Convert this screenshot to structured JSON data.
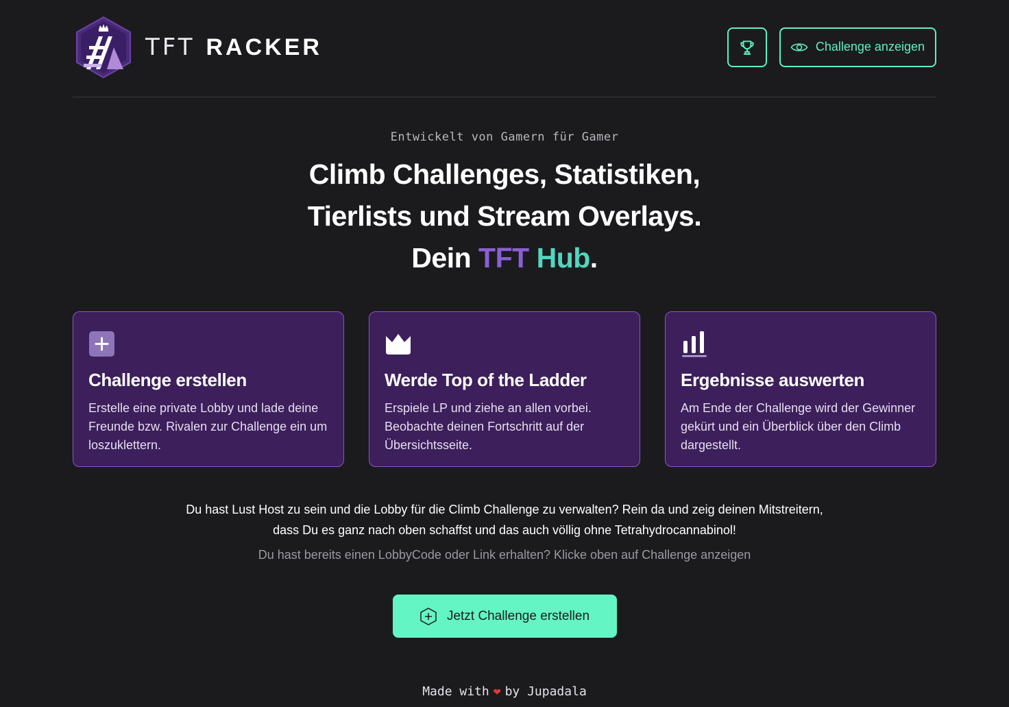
{
  "header": {
    "brand_light": "TFT",
    "brand_bold": "RACKER",
    "view_challenge_label": "Challenge anzeigen"
  },
  "hero": {
    "eyebrow": "Entwickelt von Gamern für Gamer",
    "line1": "Climb Challenges, Statistiken,",
    "line2": "Tierlists und Stream Overlays.",
    "line3_prefix": "Dein",
    "line3_tft": "TFT",
    "line3_hub": "Hub",
    "line3_dot": "."
  },
  "cards": [
    {
      "icon": "plus-square-icon",
      "title": "Challenge erstellen",
      "text": "Erstelle eine private Lobby und lade deine Freunde bzw. Rivalen zur Challenge ein um loszuklettern."
    },
    {
      "icon": "crown-icon",
      "title": "Werde Top of the Ladder",
      "text": "Erspiele LP und ziehe an allen vorbei. Beobachte deinen Fortschritt auf der Übersichtsseite."
    },
    {
      "icon": "bar-chart-icon",
      "title": "Ergebnisse auswerten",
      "text": "Am Ende der Challenge wird der Gewinner gekürt und ein Überblick über den Climb dargestellt."
    }
  ],
  "info": {
    "main_line1": "Du hast Lust Host zu sein und die Lobby für die Climb Challenge zu verwalten? Rein da und zeig deinen Mitstreitern,",
    "main_line2": "dass Du es ganz nach oben schaffst und das auch völlig ohne Tetrahydrocannabinol!",
    "sub": "Du hast bereits einen LobbyCode oder Link erhalten? Klicke oben auf Challenge anzeigen"
  },
  "cta": {
    "label": "Jetzt Challenge erstellen"
  },
  "footer": {
    "prefix": "Made with",
    "heart": "❤",
    "suffix": "by Jupadala"
  },
  "colors": {
    "background": "#1b1b1e",
    "accent": "#5ef2bf",
    "card_bg": "#3c1f5b",
    "card_border": "#8a56c9",
    "tft_purple": "#8a5fd4",
    "hub_teal": "#52d6c0"
  }
}
